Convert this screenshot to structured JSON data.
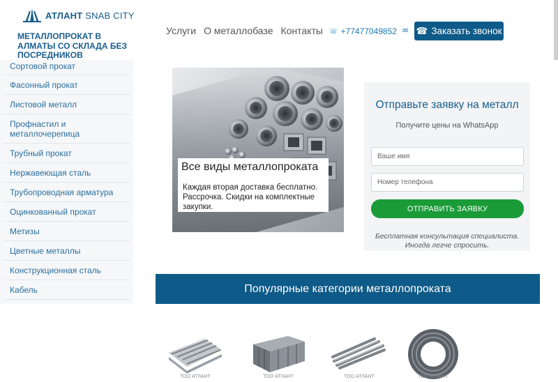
{
  "header": {
    "logo_main": "АТЛАНТ",
    "logo_sub": "SNAB CITY",
    "tagline": "МЕТАЛЛОПРОКАТ В АЛМАТЫ СО СКЛАДА БЕЗ ПОСРЕДНИКОВ",
    "nav": [
      {
        "label": "Услуги"
      },
      {
        "label": "О металлобазе"
      },
      {
        "label": "Контакты"
      }
    ],
    "phone": "+77477049852",
    "call_button": "Заказать звонок"
  },
  "sidebar": {
    "items": [
      {
        "label": "Сортовой прокат"
      },
      {
        "label": "Фасонный прокат"
      },
      {
        "label": "Листовой металл"
      },
      {
        "label": "Профнастил и металлочерепица"
      },
      {
        "label": "Трубный прокат"
      },
      {
        "label": "Нержавеющая сталь"
      },
      {
        "label": "Трубопроводная арматура"
      },
      {
        "label": "Оцинкованный прокат"
      },
      {
        "label": "Метизы"
      },
      {
        "label": "Цветные металлы"
      },
      {
        "label": "Конструкционная сталь"
      },
      {
        "label": "Кабель"
      }
    ]
  },
  "hero": {
    "title": "Все виды металлопроката",
    "text": "Каждая вторая доставка бесплатно. Рассрочка. Скидки на комплектные закупки."
  },
  "form": {
    "title": "Отправьте заявку на металл",
    "subtitle": "Получите цены на WhatsApp",
    "name_placeholder": "Ваше имя",
    "phone_placeholder": "Номер телефона",
    "submit": "ОТПРАВИТЬ ЗАЯВКУ",
    "note_line1": "Бесплатная консультация специалиста.",
    "note_line2": "Иногда легче спросить."
  },
  "categories": {
    "heading": "Популярные категории металлопроката",
    "watermark": "ТОО АТЛАНТ"
  },
  "colors": {
    "brand_blue": "#0e5a88",
    "link_blue": "#2a6f9e",
    "green": "#1b9b38"
  },
  "icons": {
    "phone": "phone-icon",
    "whatsapp": "whatsapp-icon",
    "call": "phone-call-icon"
  }
}
